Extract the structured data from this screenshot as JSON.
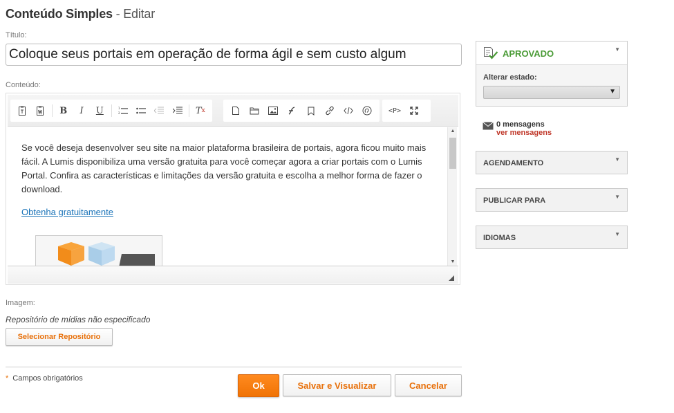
{
  "header": {
    "title_main": "Conteúdo Simples",
    "title_sep": " - ",
    "title_action": "Editar"
  },
  "form": {
    "title_label": "Título:",
    "title_value": "Coloque seus portais em operação de forma ágil e sem custo algum",
    "content_label": "Conteúdo:",
    "content_paragraph": "Se você deseja desenvolver seu site na maior plataforma brasileira de portais, agora ficou muito mais fácil. A Lumis disponibiliza uma versão gratuita para você começar agora a criar portais com o Lumis Portal. Confira as características e limitações da versão gratuita e escolha a melhor forma de fazer o download.",
    "content_link": "Obtenha gratuitamente",
    "image_label": "Imagem:",
    "image_repo_text": "Repositório de mídias não especificado",
    "select_repo_button": "Selecionar Repositório",
    "required_text": "Campos obrigatórios"
  },
  "actions": {
    "ok": "Ok",
    "save_view": "Salvar e Visualizar",
    "cancel": "Cancelar"
  },
  "toolbar_icons": [
    "paste-text-icon",
    "paste-word-icon",
    "bold-icon",
    "italic-icon",
    "underline-icon",
    "numbered-list-icon",
    "bulleted-list-icon",
    "outdent-icon",
    "indent-icon",
    "remove-format-icon",
    "new-page-icon",
    "browse-server-icon",
    "image-icon",
    "flash-icon",
    "anchor-icon",
    "link-icon",
    "source-code-icon",
    "special-char-icon",
    "show-blocks-icon",
    "maximize-icon"
  ],
  "sidebar": {
    "status": {
      "title": "APROVADO",
      "change_label": "Alterar estado:",
      "selected": ""
    },
    "messages": {
      "count": "0 mensagens",
      "link": "ver mensagens"
    },
    "panels": [
      "AGENDAMENTO",
      "PUBLICAR PARA",
      "IDIOMAS"
    ]
  },
  "colors": {
    "accent": "#e8700a",
    "approved": "#4a9b36",
    "link": "#1a73b8",
    "msg_link": "#c0392b"
  }
}
